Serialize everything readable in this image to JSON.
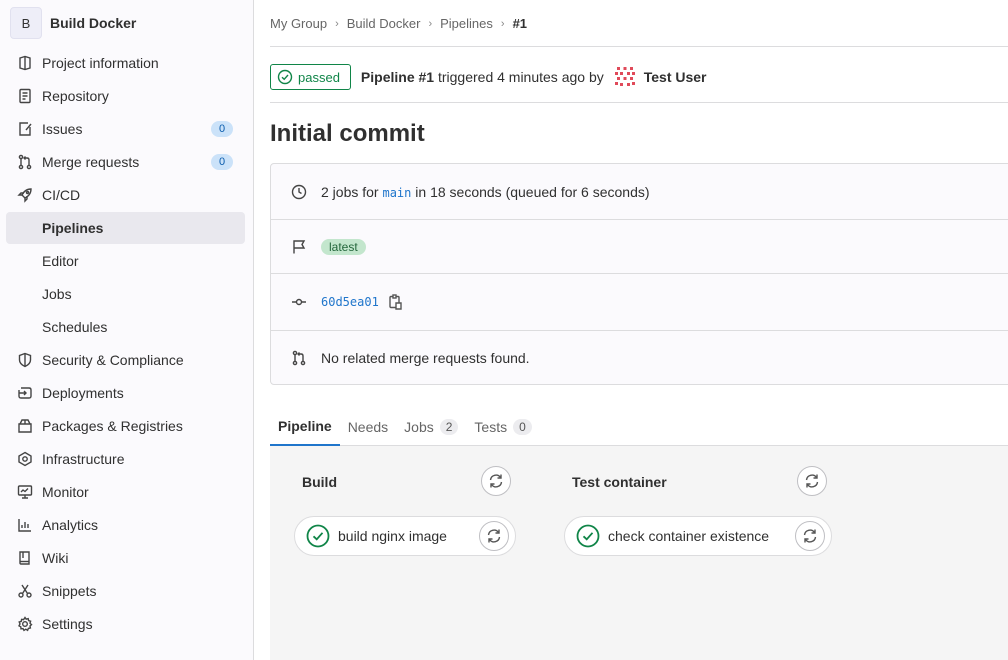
{
  "project": {
    "avatar_letter": "B",
    "name": "Build Docker"
  },
  "sidebar": {
    "items": [
      {
        "label": "Project information",
        "icon": "project-icon"
      },
      {
        "label": "Repository",
        "icon": "doc-icon"
      },
      {
        "label": "Issues",
        "icon": "issues-icon",
        "badge": "0"
      },
      {
        "label": "Merge requests",
        "icon": "merge-request-icon",
        "badge": "0"
      },
      {
        "label": "CI/CD",
        "icon": "rocket-icon"
      },
      {
        "label": "Pipelines",
        "active": true
      },
      {
        "label": "Editor"
      },
      {
        "label": "Jobs"
      },
      {
        "label": "Schedules"
      },
      {
        "label": "Security & Compliance",
        "icon": "shield-icon"
      },
      {
        "label": "Deployments",
        "icon": "deployments-icon"
      },
      {
        "label": "Packages & Registries",
        "icon": "package-icon"
      },
      {
        "label": "Infrastructure",
        "icon": "cloud-gear-icon"
      },
      {
        "label": "Monitor",
        "icon": "monitor-icon"
      },
      {
        "label": "Analytics",
        "icon": "chart-icon"
      },
      {
        "label": "Wiki",
        "icon": "book-icon"
      },
      {
        "label": "Snippets",
        "icon": "scissors-icon"
      },
      {
        "label": "Settings",
        "icon": "gear-icon"
      }
    ]
  },
  "breadcrumb": [
    "My Group",
    "Build Docker",
    "Pipelines",
    "#1"
  ],
  "header": {
    "status": "passed",
    "pipeline_label": "Pipeline #1",
    "triggered_text": "triggered 4 minutes ago by",
    "user": "Test User"
  },
  "title": "Initial commit",
  "info": {
    "jobs_prefix": "2 jobs for",
    "branch": "main",
    "jobs_suffix": "in 18 seconds (queued for 6 seconds)",
    "tag": "latest",
    "commit_sha": "60d5ea01",
    "mr_text": "No related merge requests found."
  },
  "tabs": [
    {
      "label": "Pipeline",
      "active": true
    },
    {
      "label": "Needs"
    },
    {
      "label": "Jobs",
      "count": "2"
    },
    {
      "label": "Tests",
      "count": "0"
    }
  ],
  "stages": [
    {
      "name": "Build",
      "job": "build nginx image",
      "status": "success"
    },
    {
      "name": "Test container",
      "job": "check container existence",
      "status": "success"
    }
  ],
  "colors": {
    "success": "#108548",
    "link": "#1f75cb",
    "active_tab": "#1f75cb"
  }
}
